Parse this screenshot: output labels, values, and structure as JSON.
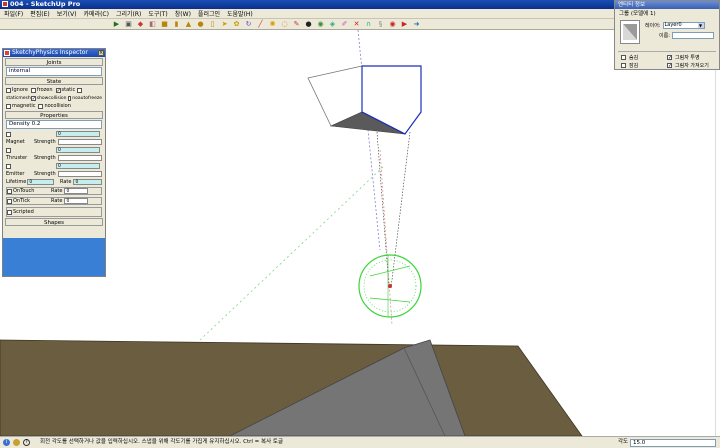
{
  "window": {
    "title": "004 - SketchUp Pro"
  },
  "menu": [
    "파일(F)",
    "편집(E)",
    "보기(V)",
    "카메라(C)",
    "그리기(R)",
    "도구(T)",
    "창(W)",
    "플러그인",
    "도움말(H)"
  ],
  "toolbar_icons": [
    "select-icon",
    "component-icon",
    "paint-icon",
    "erase-icon",
    "box-icon",
    "cylinder-icon",
    "cone-icon",
    "sphere-icon",
    "tube-icon",
    "pointer-icon",
    "gear-icon",
    "rotate-icon",
    "line-icon",
    "sun-icon",
    "orbit-icon",
    "pencil-icon",
    "record-icon",
    "cross-icon",
    "magnet-icon",
    "spring-icon"
  ],
  "physics_panel": {
    "title": "SketchyPhysics Inspector",
    "joints_header": "Joints",
    "joints_value": "internal",
    "state_header": "State",
    "state_row1": [
      "Ignore",
      "frozen",
      "static"
    ],
    "state_row2": [
      "staticmesh",
      "showcollision",
      "noautofreeze"
    ],
    "state_row3": [
      "magnetic",
      "nocollision"
    ],
    "properties_header": "Properties",
    "density_label": "Density",
    "density_value": "0.2",
    "zero": "0",
    "magnet_label": "Magnet",
    "thruster_label": "Thruster",
    "emitter_label": "Emitter",
    "strength_label": "Strength",
    "lifetime_label": "Lifetime",
    "rate_label": "Rate",
    "ontouch_label": "OnTouch",
    "ontick_label": "OnTick",
    "scripted_label": "Scripted",
    "shapes_header": "Shapes"
  },
  "entity_info": {
    "title": "엔티티 정보",
    "entity": "그룹 (모델에 1)",
    "layer_label": "레이어:",
    "layer_value": "Layer0",
    "name_label": "이름:",
    "hide_label": "숨김",
    "lock_label": "잠김",
    "cast_shadow_label": "그림자 투영",
    "receive_shadow_label": "그림자 가져오기"
  },
  "status": {
    "hint": "회전 각도를 선택하거나 값을 입력하십시오.  스냅을 위해 각도기를 가집게 유지하십시오.  Ctrl = 복사 토글",
    "measure_label": "각도",
    "measure_value": "15.0"
  },
  "colors": {
    "ground": "#6b5d40",
    "ground_edge": "#3d3524",
    "plane": "#757575",
    "protractor": "#3bd43b",
    "selection": "#1c2fb8"
  }
}
